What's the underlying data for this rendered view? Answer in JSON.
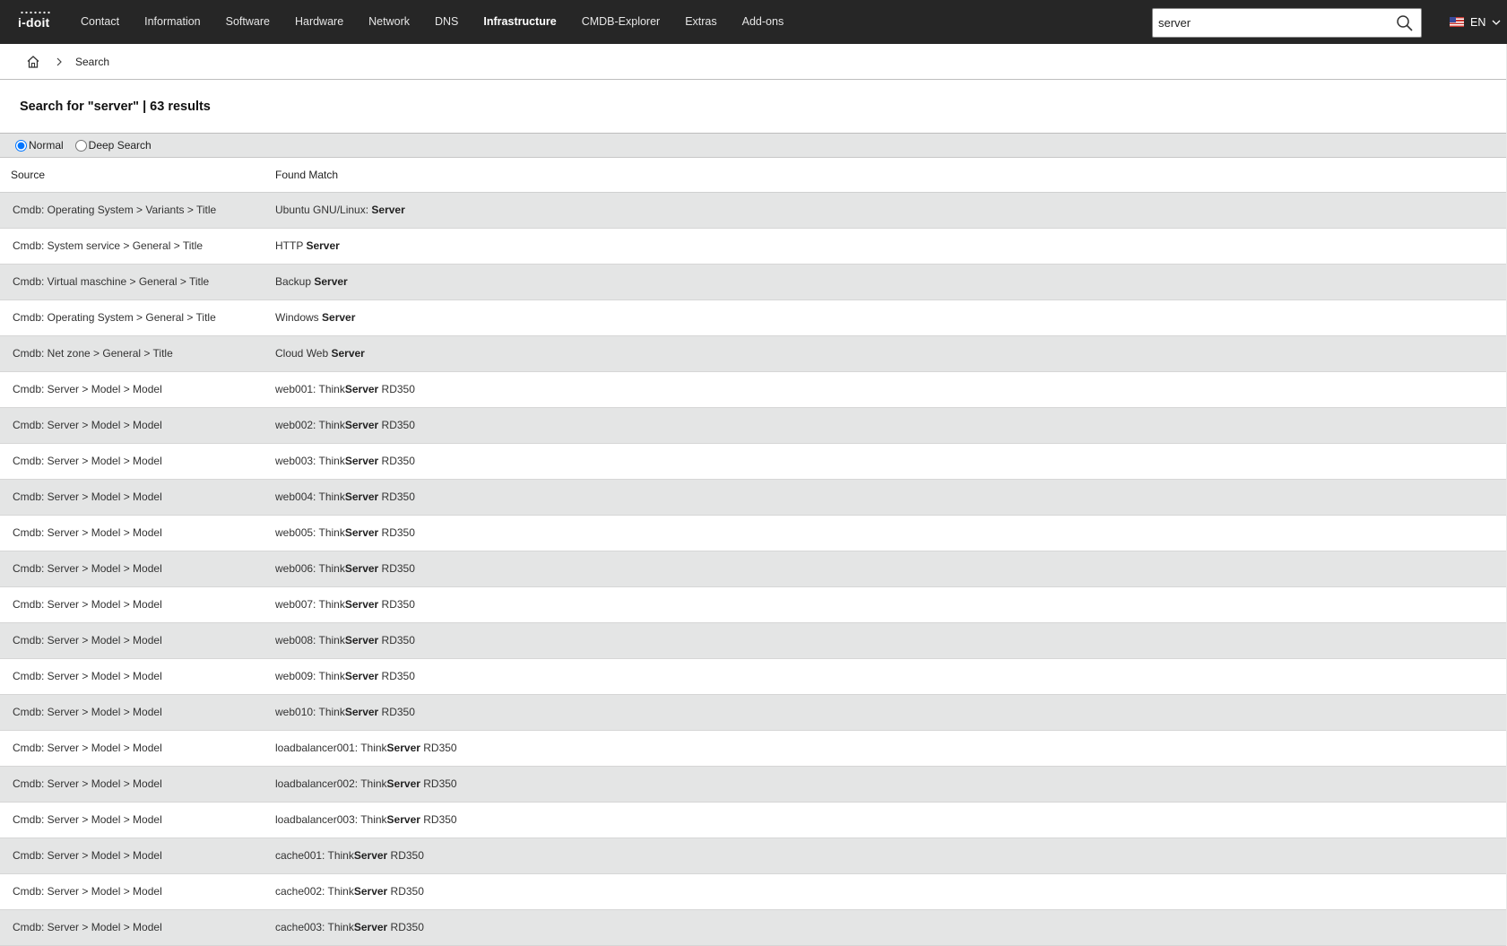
{
  "app": {
    "logo": "i-doit"
  },
  "nav": {
    "items": [
      {
        "label": "Contact",
        "active": false
      },
      {
        "label": "Information",
        "active": false
      },
      {
        "label": "Software",
        "active": false
      },
      {
        "label": "Hardware",
        "active": false
      },
      {
        "label": "Network",
        "active": false
      },
      {
        "label": "DNS",
        "active": false
      },
      {
        "label": "Infrastructure",
        "active": true
      },
      {
        "label": "CMDB-Explorer",
        "active": false
      },
      {
        "label": "Extras",
        "active": false
      },
      {
        "label": "Add-ons",
        "active": false
      }
    ]
  },
  "search": {
    "value": "server",
    "icon": "search-icon"
  },
  "language": {
    "label": "EN",
    "flag": "us-flag-icon"
  },
  "breadcrumb": {
    "home_icon": "home-icon",
    "current": "Search"
  },
  "page": {
    "title": "Search for \"server\" | 63 results"
  },
  "modes": {
    "normal_label": "Normal",
    "deep_label": "Deep Search",
    "selected": "Normal"
  },
  "table": {
    "headers": {
      "source": "Source",
      "match": "Found Match"
    },
    "rows": [
      {
        "source": "Cmdb: Operating System > Variants > Title",
        "pre": "Ubuntu GNU/Linux: ",
        "hit": "Server",
        "post": ""
      },
      {
        "source": "Cmdb: System service > General > Title",
        "pre": "HTTP ",
        "hit": "Server",
        "post": ""
      },
      {
        "source": "Cmdb: Virtual maschine > General > Title",
        "pre": "Backup ",
        "hit": "Server",
        "post": ""
      },
      {
        "source": "Cmdb: Operating System > General > Title",
        "pre": "Windows ",
        "hit": "Server",
        "post": ""
      },
      {
        "source": "Cmdb: Net zone > General > Title",
        "pre": "Cloud Web ",
        "hit": "Server",
        "post": ""
      },
      {
        "source": "Cmdb: Server > Model > Model",
        "pre": "web001: Think",
        "hit": "Server",
        "post": " RD350"
      },
      {
        "source": "Cmdb: Server > Model > Model",
        "pre": "web002: Think",
        "hit": "Server",
        "post": " RD350"
      },
      {
        "source": "Cmdb: Server > Model > Model",
        "pre": "web003: Think",
        "hit": "Server",
        "post": " RD350"
      },
      {
        "source": "Cmdb: Server > Model > Model",
        "pre": "web004: Think",
        "hit": "Server",
        "post": " RD350"
      },
      {
        "source": "Cmdb: Server > Model > Model",
        "pre": "web005: Think",
        "hit": "Server",
        "post": " RD350"
      },
      {
        "source": "Cmdb: Server > Model > Model",
        "pre": "web006: Think",
        "hit": "Server",
        "post": " RD350"
      },
      {
        "source": "Cmdb: Server > Model > Model",
        "pre": "web007: Think",
        "hit": "Server",
        "post": " RD350"
      },
      {
        "source": "Cmdb: Server > Model > Model",
        "pre": "web008: Think",
        "hit": "Server",
        "post": " RD350"
      },
      {
        "source": "Cmdb: Server > Model > Model",
        "pre": "web009: Think",
        "hit": "Server",
        "post": " RD350"
      },
      {
        "source": "Cmdb: Server > Model > Model",
        "pre": "web010: Think",
        "hit": "Server",
        "post": " RD350"
      },
      {
        "source": "Cmdb: Server > Model > Model",
        "pre": "loadbalancer001: Think",
        "hit": "Server",
        "post": " RD350"
      },
      {
        "source": "Cmdb: Server > Model > Model",
        "pre": "loadbalancer002: Think",
        "hit": "Server",
        "post": " RD350"
      },
      {
        "source": "Cmdb: Server > Model > Model",
        "pre": "loadbalancer003: Think",
        "hit": "Server",
        "post": " RD350"
      },
      {
        "source": "Cmdb: Server > Model > Model",
        "pre": "cache001: Think",
        "hit": "Server",
        "post": " RD350"
      },
      {
        "source": "Cmdb: Server > Model > Model",
        "pre": "cache002: Think",
        "hit": "Server",
        "post": " RD350"
      },
      {
        "source": "Cmdb: Server > Model > Model",
        "pre": "cache003: Think",
        "hit": "Server",
        "post": " RD350"
      }
    ]
  },
  "colors": {
    "topbar": "#262626",
    "row_alt": "#e4e5e5",
    "radio_accent": "#1a73e8"
  }
}
